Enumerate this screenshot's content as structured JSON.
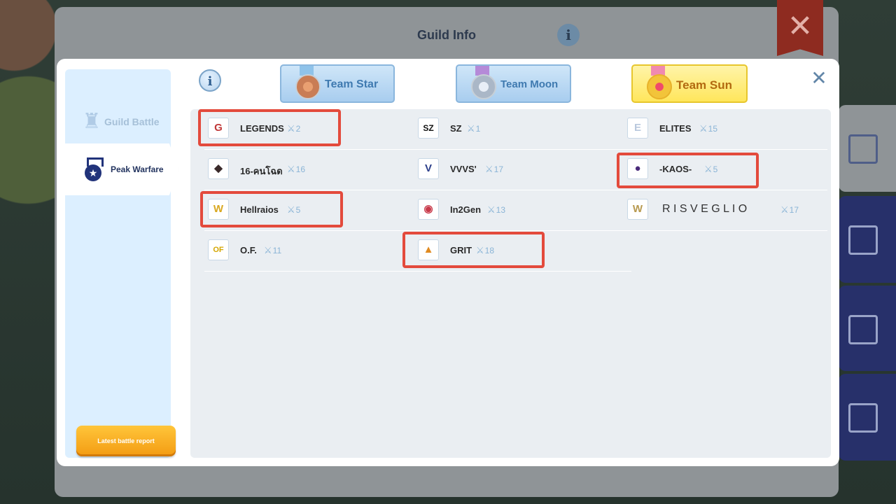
{
  "background": {
    "title": "Guild Info",
    "info_glyph": "i",
    "close_glyph": "✕"
  },
  "sidebar": {
    "items": [
      {
        "label": "Guild Battle",
        "icon": "castle-icon",
        "active": false
      },
      {
        "label": "Peak Warfare",
        "icon": "medal-icon",
        "active": true
      }
    ],
    "report_button": "Latest battle report"
  },
  "header": {
    "info_glyph": "i",
    "close_glyph": "✕",
    "tabs": [
      {
        "label": "Team Star",
        "icon": "bronze-medal-icon",
        "active": false
      },
      {
        "label": "Team Moon",
        "icon": "silver-medal-icon",
        "active": false
      },
      {
        "label": "Team Sun",
        "icon": "gold-medal-icon",
        "active": true
      }
    ]
  },
  "guilds": [
    {
      "name": "LEGENDS",
      "rank": "2",
      "emblem": "G",
      "highlighted": true
    },
    {
      "name": "SZ",
      "rank": "1",
      "emblem": "SZ",
      "highlighted": false
    },
    {
      "name": "ELITES",
      "rank": "15",
      "emblem": "E",
      "highlighted": false
    },
    {
      "name": "16-คนโฉด",
      "rank": "16",
      "emblem": "◆",
      "highlighted": false
    },
    {
      "name": "VVVS'",
      "rank": "17",
      "emblem": "V",
      "highlighted": false
    },
    {
      "name": "-KAOS-",
      "rank": "5",
      "emblem": "●",
      "highlighted": true
    },
    {
      "name": "Hellraios",
      "rank": "5",
      "emblem": "W",
      "highlighted": true
    },
    {
      "name": "In2Gen",
      "rank": "13",
      "emblem": "◉",
      "highlighted": false
    },
    {
      "name": "R I S V E G L I O",
      "rank": "17",
      "emblem": "W",
      "highlighted": false
    },
    {
      "name": "O.F.",
      "rank": "11",
      "emblem": "OF",
      "highlighted": false
    },
    {
      "name": "GRIT",
      "rank": "18",
      "emblem": "▲",
      "highlighted": true
    }
  ],
  "colors": {
    "highlight": "#e34a3c",
    "accent_blue": "#3f7ab0",
    "sun_gold": "#ffe65c"
  }
}
